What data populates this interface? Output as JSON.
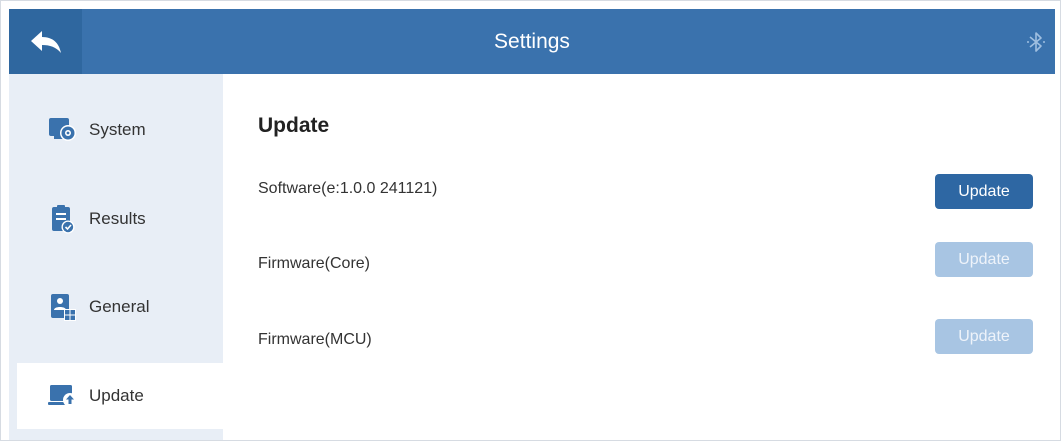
{
  "header": {
    "title": "Settings",
    "accent_color": "#3a72ad",
    "back_icon": "back-arrow-icon",
    "bluetooth_icon": "bluetooth-icon"
  },
  "sidebar": {
    "background": "#e8eef6",
    "items": [
      {
        "label": "System",
        "icon": "system-settings-icon",
        "active": false
      },
      {
        "label": "Results",
        "icon": "clipboard-check-icon",
        "active": false
      },
      {
        "label": "General",
        "icon": "user-grid-icon",
        "active": false
      },
      {
        "label": "Update",
        "icon": "laptop-upload-icon",
        "active": true
      }
    ]
  },
  "main": {
    "section_title": "Update",
    "rows": [
      {
        "label": "Software(e:1.0.0 241121)",
        "button_label": "Update",
        "enabled": true
      },
      {
        "label": "Firmware(Core)",
        "button_label": "Update",
        "enabled": false
      },
      {
        "label": "Firmware(MCU)",
        "button_label": "Update",
        "enabled": false
      }
    ],
    "button_enabled_color": "#2e67a3",
    "button_disabled_color": "#a8c5e3"
  }
}
